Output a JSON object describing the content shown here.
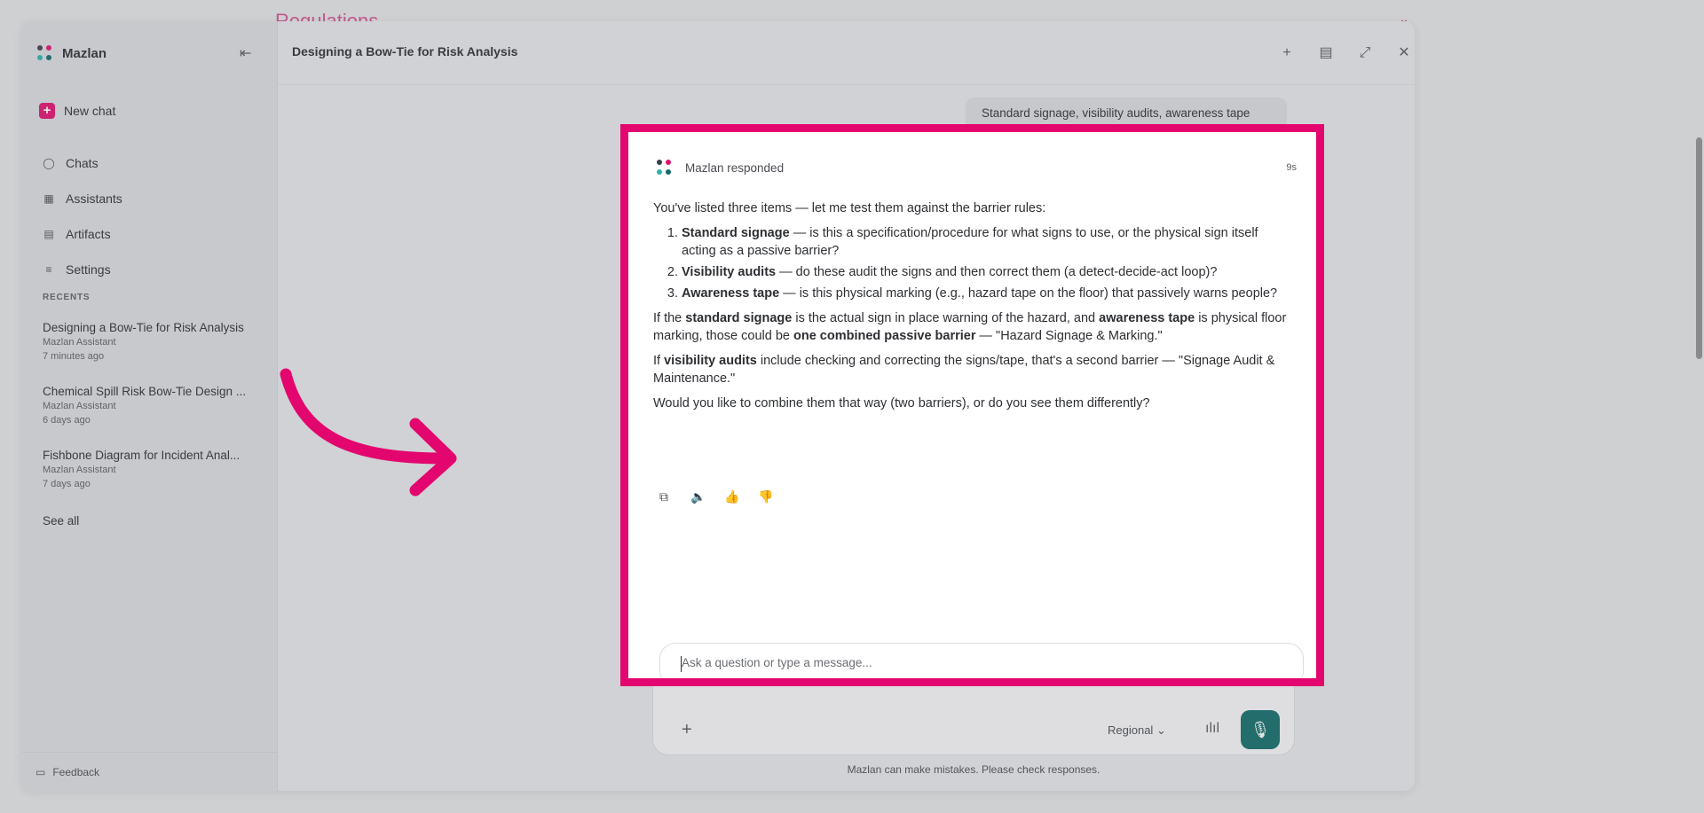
{
  "background": {
    "heading": "Regulations"
  },
  "sidebar": {
    "brand": "Mazlan",
    "new_chat": "New chat",
    "nav": [
      {
        "label": "Chats",
        "icon": "chat-icon"
      },
      {
        "label": "Assistants",
        "icon": "grid-icon"
      },
      {
        "label": "Artifacts",
        "icon": "document-icon"
      },
      {
        "label": "Settings",
        "icon": "sliders-icon"
      }
    ],
    "recents_title": "RECENTS",
    "recents": [
      {
        "title": "Designing a Bow-Tie for Risk Analysis",
        "assistant": "Mazlan Assistant",
        "time": "7 minutes ago"
      },
      {
        "title": "Chemical Spill Risk Bow-Tie Design ...",
        "assistant": "Mazlan Assistant",
        "time": "6 days ago"
      },
      {
        "title": "Fishbone Diagram for Incident Anal...",
        "assistant": "Mazlan Assistant",
        "time": "7 days ago"
      }
    ],
    "see_all": "See all",
    "feedback": "Feedback"
  },
  "header": {
    "title": "Designing a Bow-Tie for Risk Analysis"
  },
  "user_message": "Standard signage, visibility audits, awareness tape",
  "response": {
    "author": "Mazlan responded",
    "duration": "9s",
    "intro": "You've listed three items — let me test them against the barrier rules:",
    "items": [
      {
        "bold": "Standard signage",
        "text": " — is this a specification/procedure for what signs to use, or the physical sign itself acting as a passive barrier?"
      },
      {
        "bold": "Visibility audits",
        "text": " — do these audit the signs and then correct them (a detect-decide-act loop)?"
      },
      {
        "bold": "Awareness tape",
        "text": " — is this physical marking (e.g., hazard tape on the floor) that passively warns people?"
      }
    ],
    "p1": {
      "a": "If the ",
      "b1": "standard signage",
      "c": " is the actual sign in place warning of the hazard, and ",
      "b2": "awareness tape",
      "d": " is physical floor marking, those could be ",
      "b3": "one combined passive barrier",
      "e": " — \"Hazard Signage & Marking.\""
    },
    "p2": {
      "a": "If ",
      "b1": "visibility audits",
      "c": " include checking and correcting the signs/tape, that's a second barrier — \"Signage Audit & Maintenance.\""
    },
    "p3": "Would you like to combine them that way (two barriers), or do you see them differently?"
  },
  "composer": {
    "placeholder": "Ask a question or type a message...",
    "region": "Regional",
    "disclaimer": "Mazlan can make mistakes. Please check responses."
  },
  "colors": {
    "accent": "#e4066f",
    "teal": "#116b68"
  }
}
